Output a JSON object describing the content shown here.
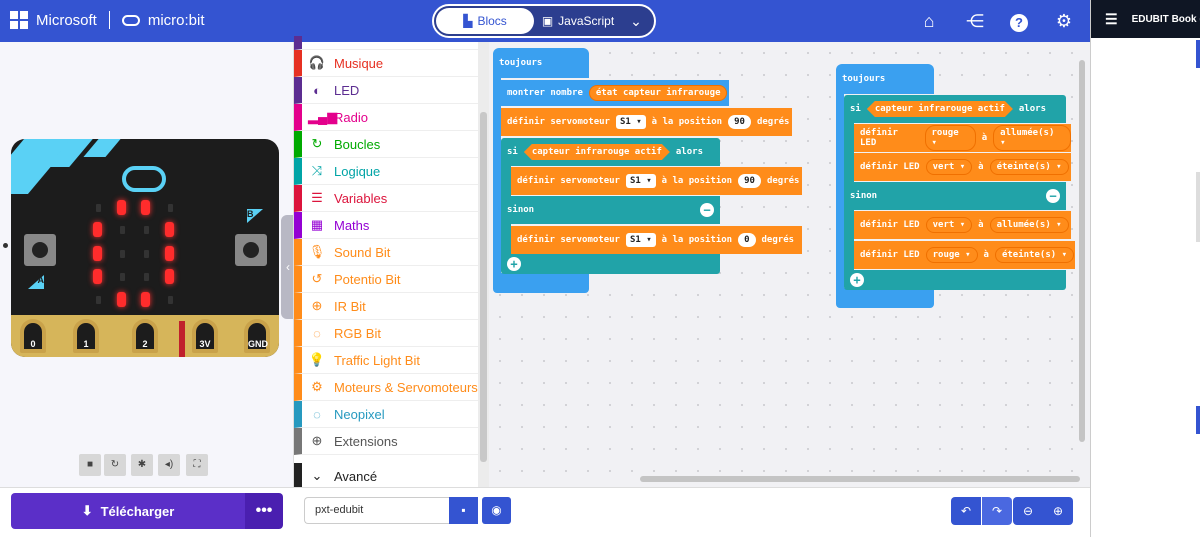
{
  "header": {
    "brand": "Microsoft",
    "product": "micro:bit",
    "mode_blocks": "Blocs",
    "mode_js": "JavaScript",
    "icons": [
      "home-icon",
      "share-icon",
      "help-icon",
      "settings-icon"
    ]
  },
  "side_panel": {
    "title": "EDUBIT Book (F"
  },
  "simulator": {
    "pins": [
      "0",
      "1",
      "2",
      "3V",
      "GND"
    ],
    "button_a": "A",
    "button_b": "B"
  },
  "toolbox": {
    "categories": [
      {
        "label": "Musique",
        "color": "#e63022",
        "icon": "headphones-icon"
      },
      {
        "label": "LED",
        "color": "#5c2d91",
        "icon": "toggle-icon"
      },
      {
        "label": "Radio",
        "color": "#e3008c",
        "icon": "signal-icon"
      },
      {
        "label": "Boucles",
        "color": "#00aa00",
        "icon": "loop-icon"
      },
      {
        "label": "Logique",
        "color": "#00a4a6",
        "icon": "shuffle-icon"
      },
      {
        "label": "Variables",
        "color": "#dc143c",
        "icon": "list-icon"
      },
      {
        "label": "Maths",
        "color": "#9400d3",
        "icon": "calculator-icon"
      },
      {
        "label": "Sound Bit",
        "color": "#ff8c1a",
        "icon": "mic-icon"
      },
      {
        "label": "Potentio Bit",
        "color": "#ff8c1a",
        "icon": "refresh-icon"
      },
      {
        "label": "IR Bit",
        "color": "#ff8c1a",
        "icon": "crosshair-icon"
      },
      {
        "label": "RGB Bit",
        "color": "#ff8c1a",
        "icon": "dotted-circle-icon"
      },
      {
        "label": "Traffic Light Bit",
        "color": "#ff8c1a",
        "icon": "bulb-icon"
      },
      {
        "label": "Moteurs & Servomoteurs",
        "color": "#ff8c1a",
        "icon": "cogs-icon"
      },
      {
        "label": "Neopixel",
        "color": "#2699bf",
        "icon": "dotted-circle-icon"
      },
      {
        "label": "Extensions",
        "color": "#777777",
        "icon": "plus-circle-icon"
      },
      {
        "label": "Avancé",
        "color": "#222222",
        "icon": "chevron-down-icon"
      }
    ]
  },
  "program1": {
    "hat": "toujours",
    "show": "montrer nombre",
    "ir_state": "état capteur infrarouge",
    "servo_def": "définir servomoteur",
    "servo": "S1",
    "at_pos": "à la position",
    "deg": "degrés",
    "val1": "90",
    "val2": "90",
    "val3": "0",
    "if": "si",
    "cond": "capteur infrarouge actif",
    "then": "alors",
    "else": "sinon"
  },
  "program2": {
    "hat": "toujours",
    "if": "si",
    "cond": "capteur infrarouge actif",
    "then": "alors",
    "else": "sinon",
    "led_def": "définir LED",
    "a": "à",
    "red": "rouge",
    "green": "vert",
    "on": "allumée(s)",
    "off": "éteinte(s)"
  },
  "bottom": {
    "download": "Télécharger",
    "more": "•••",
    "project_name": "pxt-edubit"
  }
}
